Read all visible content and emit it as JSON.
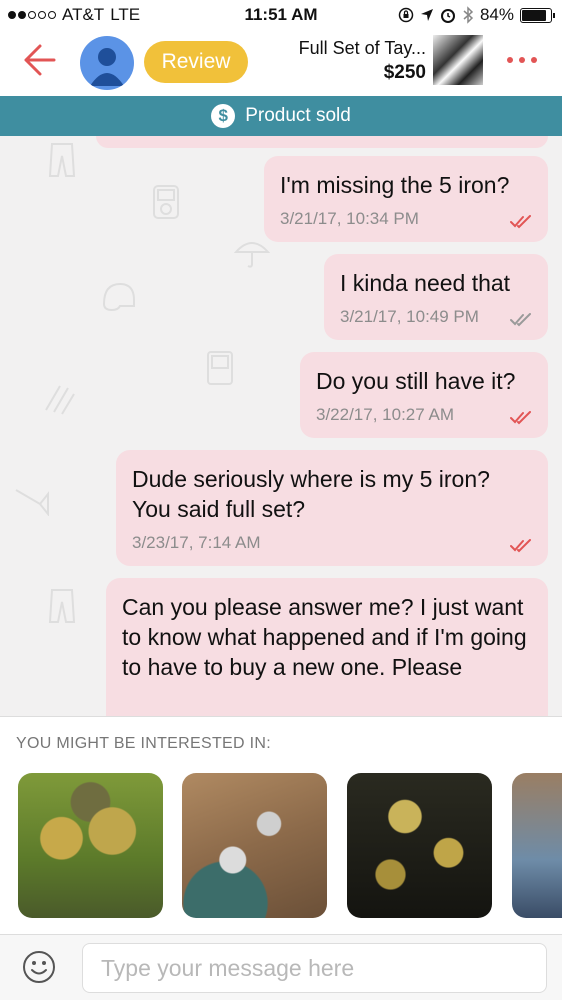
{
  "status_bar": {
    "carrier": "AT&T",
    "network": "LTE",
    "time": "11:51 AM",
    "battery": "84%",
    "battery_level": 0.84
  },
  "header": {
    "review_label": "Review",
    "product_title": "Full Set of Tay...",
    "product_price": "$250"
  },
  "banner": {
    "text": "Product sold",
    "color": "#3f8ea0"
  },
  "messages": [
    {
      "text": "I'm missing the 5 iron?",
      "time": "3/21/17, 10:34 PM",
      "status": "read"
    },
    {
      "text": "I kinda need that",
      "time": "3/21/17, 10:49 PM",
      "status": "delivered"
    },
    {
      "text": "Do you still have it?",
      "time": "3/22/17, 10:27 AM",
      "status": "read"
    },
    {
      "text": "Dude seriously where is my 5 iron? You said full set?",
      "time": "3/23/17, 7:14 AM",
      "status": "read"
    },
    {
      "text": "Can you please answer me? I just want to know what happened and if I'm going to have to buy a new one. Please",
      "time": "",
      "status": ""
    }
  ],
  "suggestions": {
    "title": "YOU MIGHT BE INTERESTED IN:"
  },
  "input": {
    "placeholder": "Type your message here"
  },
  "colors": {
    "accent": "#e25555",
    "review": "#f1c13a",
    "bubble": "#f7dde2",
    "read_check": "#e25555",
    "delivered_check": "#9a9a9a"
  },
  "icons": [
    "back-arrow-icon",
    "avatar-icon",
    "more-icon",
    "dollar-icon",
    "check-icon",
    "emoji-icon"
  ]
}
